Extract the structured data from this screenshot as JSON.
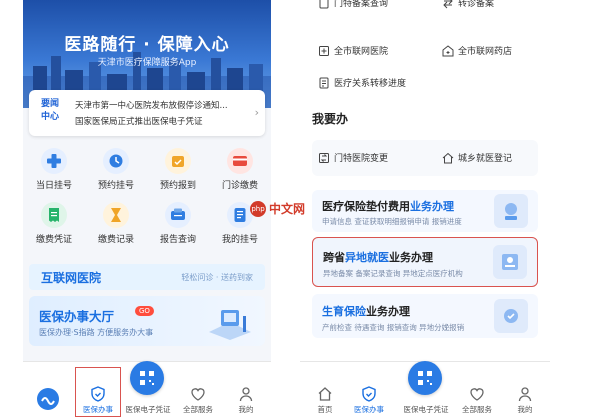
{
  "left": {
    "banner": {
      "title": "医路随行 · 保障入心",
      "subtitle": "天津市医疗保障服务App"
    },
    "news": {
      "logo_line1": "要闻",
      "logo_line2": "中心",
      "items": [
        "天津市第一中心医院发布放假停诊通知...",
        "国家医保局正式推出医保电子凭证"
      ]
    },
    "grid": [
      {
        "label": "当日挂号",
        "icon": "hospital-cross-icon",
        "color": "#2f7de1"
      },
      {
        "label": "预约挂号",
        "icon": "clock-icon",
        "color": "#2f7de1"
      },
      {
        "label": "预约报到",
        "icon": "checkin-icon",
        "color": "#f0a528"
      },
      {
        "label": "门诊缴费",
        "icon": "payment-card-icon",
        "color": "#e84a3c"
      },
      {
        "label": "缴费凭证",
        "icon": "receipt-icon",
        "color": "#27b36b"
      },
      {
        "label": "缴费记录",
        "icon": "record-icon",
        "color": "#f0a528"
      },
      {
        "label": "报告查询",
        "icon": "report-icon",
        "color": "#2f7de1"
      },
      {
        "label": "我的挂号",
        "icon": "my-registration-icon",
        "color": "#2f7de1"
      }
    ],
    "internet_hospital": {
      "title": "互联网医院",
      "subtitle": "轻松问诊 · 送药到家"
    },
    "service_hall": {
      "title": "医保办事大厅",
      "badge": "GO",
      "subtitle": "医保办理·S指路 方便服务办大事"
    },
    "tabs": [
      {
        "label": "医保办事",
        "icon": "shield-icon"
      },
      {
        "label": "医保电子凭证",
        "icon": "qr-code-icon"
      },
      {
        "label": "全部服务",
        "icon": "heart-icon"
      },
      {
        "label": "我的",
        "icon": "person-icon"
      }
    ]
  },
  "right": {
    "top_items": [
      {
        "label": "门特备案查询",
        "icon": "file-icon"
      },
      {
        "label": "转诊备案",
        "icon": "transfer-icon"
      },
      {
        "label": "全市联网医院",
        "icon": "hospital-icon"
      },
      {
        "label": "全市联网药店",
        "icon": "pharmacy-icon"
      },
      {
        "label": "医疗关系转移进度",
        "icon": "progress-icon"
      }
    ],
    "section_title": "我要办",
    "do_items": [
      {
        "label": "门特医院变更",
        "icon": "change-icon"
      },
      {
        "label": "城乡就医登记",
        "icon": "home-icon"
      }
    ],
    "cards": [
      {
        "title_pre": "",
        "title_hl": "医疗保险垫付费用",
        "title_post": "业务办理",
        "desc": "申请信息  查证获取明细报销申请  报销进度"
      },
      {
        "title_pre": "跨省",
        "title_hl": "异地就医",
        "title_post": "业务办理",
        "desc": "异地备案  备案记录查询  异地定点医疗机构"
      },
      {
        "title_pre": "",
        "title_hl": "生育保险",
        "title_post": "业务办理",
        "desc": "产前检查  待遇查询  报销查询  异地分娩报销"
      }
    ],
    "tabs": [
      {
        "label": "首页",
        "icon": "home-icon"
      },
      {
        "label": "医保办事",
        "icon": "shield-icon"
      },
      {
        "label": "医保电子凭证",
        "icon": "qr-code-icon"
      },
      {
        "label": "全部服务",
        "icon": "heart-icon"
      },
      {
        "label": "我的",
        "icon": "person-icon"
      }
    ]
  },
  "watermark": {
    "logo": "php",
    "text": "中文网"
  },
  "colors": {
    "accent": "#1a6fe0",
    "highlight_box": "#d9534f"
  }
}
